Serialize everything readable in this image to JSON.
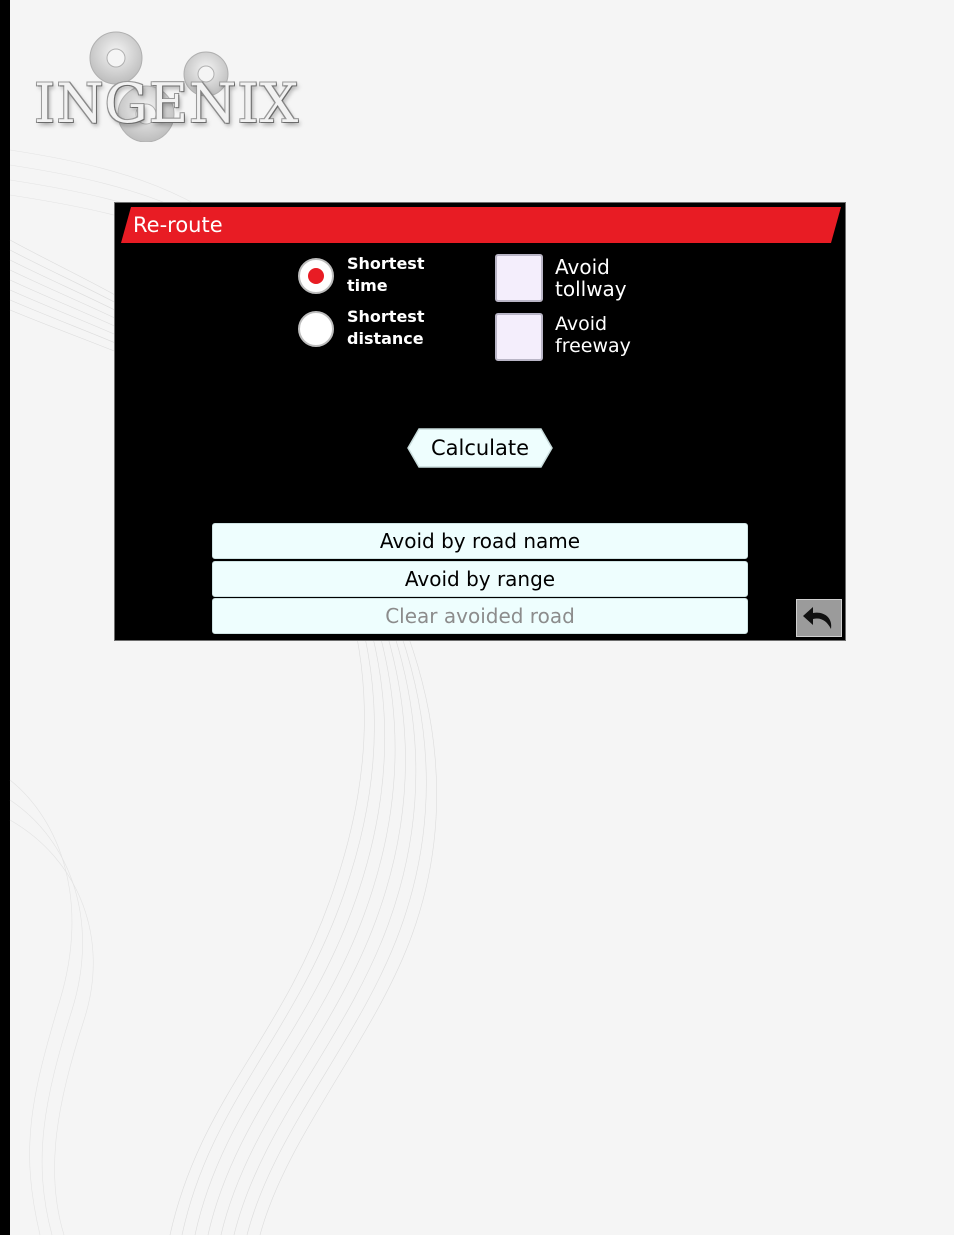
{
  "brand": {
    "logo_text": "INGENIX"
  },
  "dialog": {
    "title": "Re-route",
    "route_options": [
      {
        "label_line1": "Shortest",
        "label_line2": "time",
        "selected": true
      },
      {
        "label_line1": "Shortest",
        "label_line2": "distance",
        "selected": false
      }
    ],
    "avoid_options": [
      {
        "label_line1": "Avoid",
        "label_line2": "tollway",
        "checked": false
      },
      {
        "label_line1": "Avoid",
        "label_line2": "freeway",
        "checked": false
      }
    ],
    "calculate_label": "Calculate",
    "buttons": {
      "avoid_by_road_name": "Avoid by road name",
      "avoid_by_range": "Avoid by range",
      "clear_avoided_road": "Clear avoided road"
    },
    "back_icon": "undo-arrow-icon"
  },
  "colors": {
    "accent_red": "#e81c24",
    "screen_bg": "#000000",
    "button_bg": "#eefefe",
    "checkbox_bg": "#f4eefc",
    "disabled_text": "#8c8c8c"
  }
}
